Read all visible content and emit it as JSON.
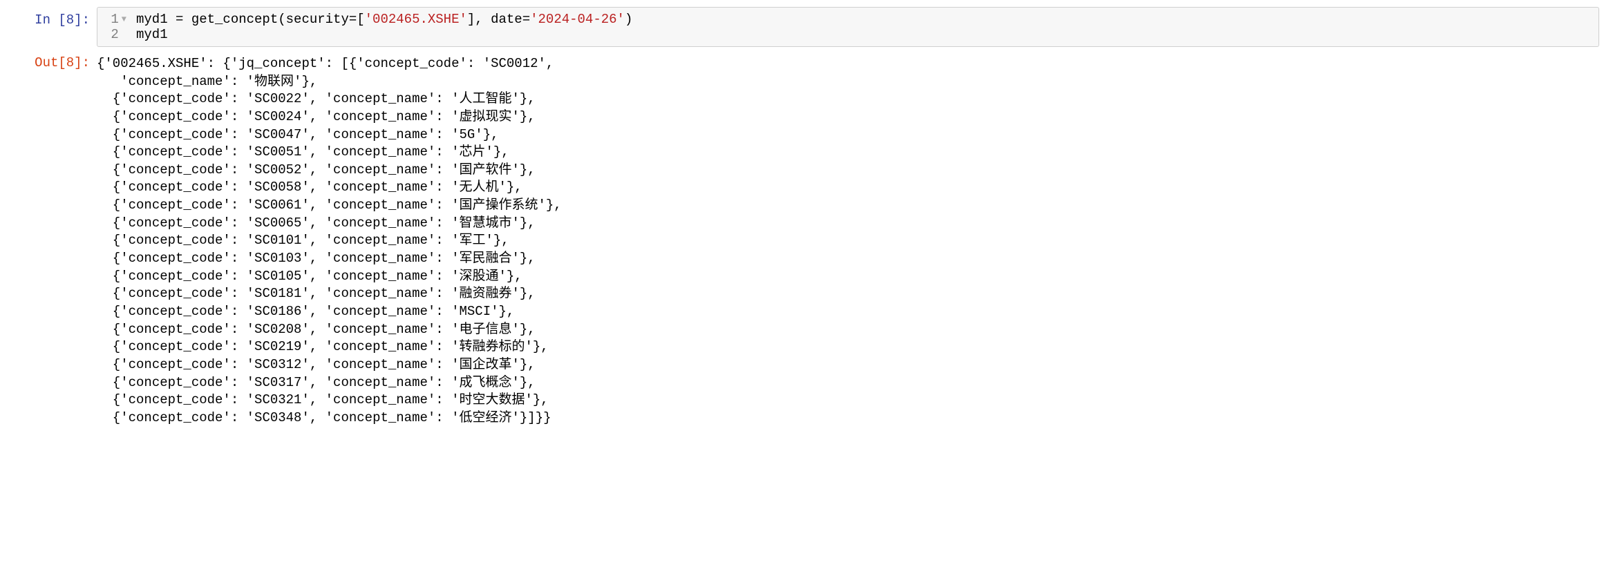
{
  "input_prompt": "In [8]:",
  "output_prompt": "Out[8]:",
  "code": {
    "line1_num": "1",
    "line2_num": "2",
    "line1_p1": "myd1 = get_concept(security=[",
    "line1_str1": "'002465.XSHE'",
    "line1_p2": "], date=",
    "line1_str2": "'2024-04-26'",
    "line1_p3": ")",
    "line2": "myd1"
  },
  "output": {
    "security": "002465.XSHE",
    "list_key": "jq_concept",
    "code_key": "concept_code",
    "name_key": "concept_name",
    "items": [
      {
        "code": "SC0012",
        "name": "物联网"
      },
      {
        "code": "SC0022",
        "name": "人工智能"
      },
      {
        "code": "SC0024",
        "name": "虚拟现实"
      },
      {
        "code": "SC0047",
        "name": "5G"
      },
      {
        "code": "SC0051",
        "name": "芯片"
      },
      {
        "code": "SC0052",
        "name": "国产软件"
      },
      {
        "code": "SC0058",
        "name": "无人机"
      },
      {
        "code": "SC0061",
        "name": "国产操作系统"
      },
      {
        "code": "SC0065",
        "name": "智慧城市"
      },
      {
        "code": "SC0101",
        "name": "军工"
      },
      {
        "code": "SC0103",
        "name": "军民融合"
      },
      {
        "code": "SC0105",
        "name": "深股通"
      },
      {
        "code": "SC0181",
        "name": "融资融券"
      },
      {
        "code": "SC0186",
        "name": "MSCI"
      },
      {
        "code": "SC0208",
        "name": "电子信息"
      },
      {
        "code": "SC0219",
        "name": "转融券标的"
      },
      {
        "code": "SC0312",
        "name": "国企改革"
      },
      {
        "code": "SC0317",
        "name": "成飞概念"
      },
      {
        "code": "SC0321",
        "name": "时空大数据"
      },
      {
        "code": "SC0348",
        "name": "低空经济"
      }
    ]
  }
}
